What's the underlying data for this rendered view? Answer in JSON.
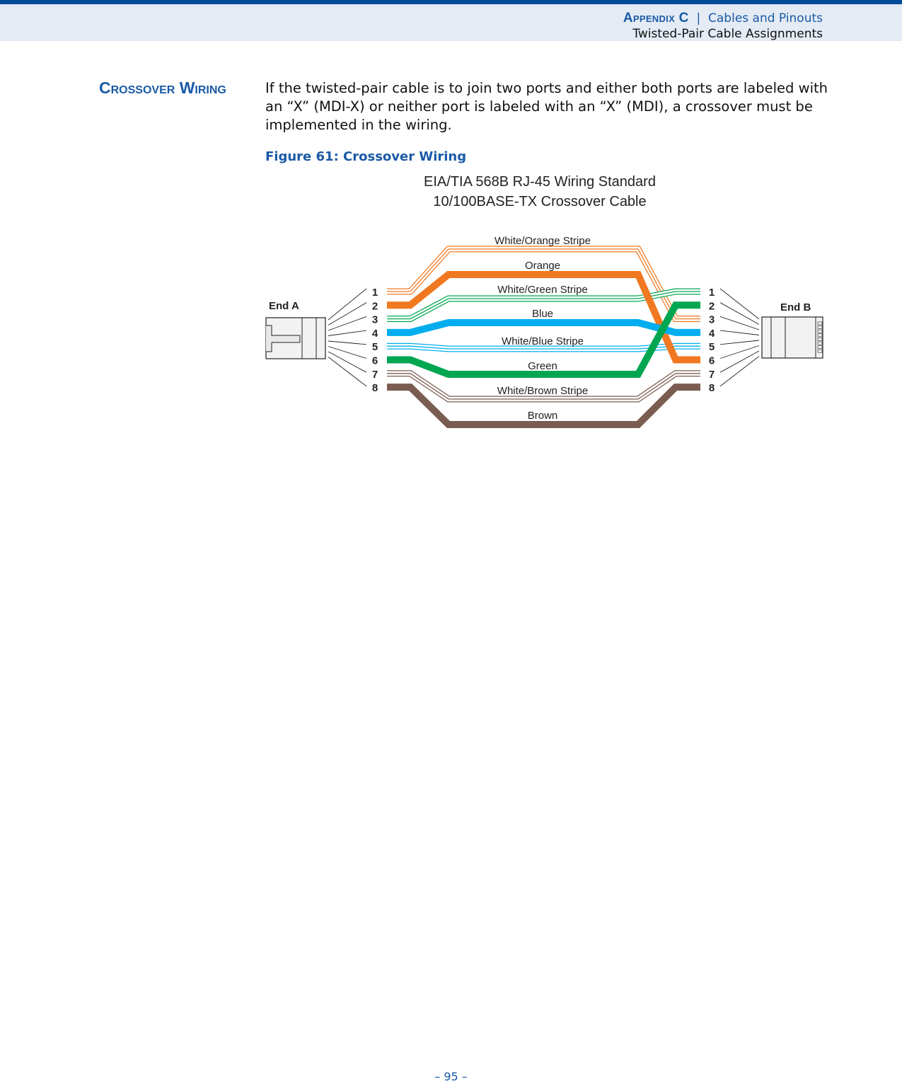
{
  "header": {
    "appendix_label": "Appendix C",
    "separator": "|",
    "chapter": "Cables and Pinouts",
    "section": "Twisted-Pair Cable Assignments"
  },
  "section_heading": "Crossover Wiring",
  "body_text": "If the twisted-pair cable is to join two ports and either both ports are labeled with an “X” (MDI-X) or neither port is labeled with an “X” (MDI), a crossover must be implemented in the wiring.",
  "figure": {
    "caption": "Figure 61:  Crossover Wiring",
    "title_line1": "EIA/TIA 568B RJ-45 Wiring Standard",
    "title_line2": "10/100BASE-TX Crossover Cable",
    "end_a_label": "End A",
    "end_b_label": "End B",
    "wires": [
      {
        "label": "White/Orange Stripe",
        "color": "#f07820",
        "striped": true,
        "pin_a": 1,
        "pin_b": 3
      },
      {
        "label": "Orange",
        "color": "#f07820",
        "striped": false,
        "pin_a": 2,
        "pin_b": 6
      },
      {
        "label": "White/Green Stripe",
        "color": "#00a650",
        "striped": true,
        "pin_a": 3,
        "pin_b": 1
      },
      {
        "label": "Blue",
        "color": "#00aeef",
        "striped": false,
        "pin_a": 4,
        "pin_b": 4
      },
      {
        "label": "White/Blue Stripe",
        "color": "#00aeef",
        "striped": true,
        "pin_a": 5,
        "pin_b": 5
      },
      {
        "label": "Green",
        "color": "#00a650",
        "striped": false,
        "pin_a": 6,
        "pin_b": 2
      },
      {
        "label": "White/Brown Stripe",
        "color": "#7a5c50",
        "striped": true,
        "pin_a": 7,
        "pin_b": 7
      },
      {
        "label": "Brown",
        "color": "#7a5c50",
        "striped": false,
        "pin_a": 8,
        "pin_b": 8
      }
    ],
    "pins": [
      "1",
      "2",
      "3",
      "4",
      "5",
      "6",
      "7",
      "8"
    ]
  },
  "footer": {
    "page_number": "–  95  –"
  }
}
